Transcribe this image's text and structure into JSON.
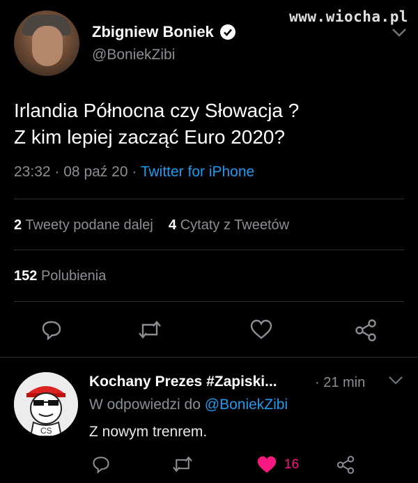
{
  "watermark": "www.wiocha.pl",
  "tweet": {
    "author_name": "Zbigniew Boniek",
    "author_handle": "@BoniekZibi",
    "text_line1": "Irlandia Północna czy Słowacja ?",
    "text_line2": "Z kim lepiej zacząć Euro 2020?",
    "time": "23:32",
    "date": "08 paź 20",
    "separator": "·",
    "client": "Twitter for iPhone",
    "retweets_count": "2",
    "retweets_label": "Tweety podane dalej",
    "quotes_count": "4",
    "quotes_label": "Cytaty z Tweetów",
    "likes_count": "152",
    "likes_label": "Polubienia"
  },
  "reply": {
    "author_name": "Kochany Prezes #Zapiski...",
    "time": "· 21 min",
    "replying_prefix": "W odpowiedzi do",
    "replying_handle": "@BoniekZibi",
    "text": "Z nowym trenrem.",
    "like_count": "16",
    "avatar_text": "CS"
  },
  "icons": [
    "reply-icon",
    "retweet-icon",
    "like-icon",
    "share-icon",
    "verified-icon",
    "chevron-down-icon"
  ],
  "colors": {
    "accent": "#1d9bf0",
    "like": "#f91880",
    "background": "#000000"
  }
}
